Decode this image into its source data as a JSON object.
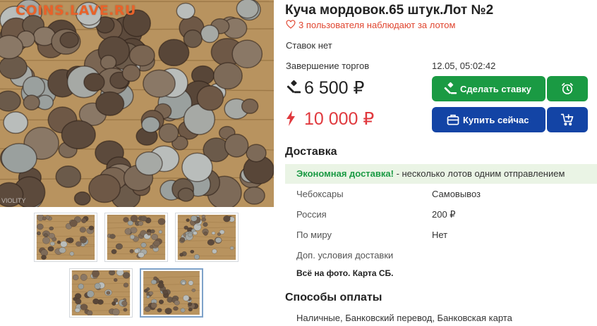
{
  "gallery": {
    "watermark": "COINS.LAVE.RU",
    "corner_mark": "VIOLITY",
    "thumbnail_count": 5
  },
  "lot": {
    "title": "Куча мордовок.65 штук.Лот №2",
    "watchers": "3 пользователя наблюдают за лотом",
    "bids": "Ставок нет",
    "end_label": "Завершение торгов",
    "end_value": "12.05, 05:02:42",
    "current_price": "6 500 ₽",
    "buy_now_price": "10 000 ₽"
  },
  "actions": {
    "bid_label": "Сделать ставку",
    "buy_label": "Купить сейчас"
  },
  "delivery": {
    "title": "Доставка",
    "promo_highlight": "Экономная доставка!",
    "promo_text": " - несколько лотов одним отправлением",
    "rows": [
      {
        "label": "Чебоксары",
        "value": "Самовывоз"
      },
      {
        "label": "Россия",
        "value": "200 ₽"
      },
      {
        "label": "По миру",
        "value": "Нет"
      }
    ],
    "extra_label": "Доп. условия доставки",
    "extra_value": "Всё на фото. Карта СБ."
  },
  "payment": {
    "title": "Способы оплаты",
    "methods": "Наличные, Банковский перевод, Банковская карта"
  },
  "colors": {
    "bid_green": "#1a9a43",
    "buy_blue": "#1344a5",
    "price_red": "#e0393e",
    "watch_red": "#e0452f",
    "watermark_orange": "#e8622a"
  }
}
